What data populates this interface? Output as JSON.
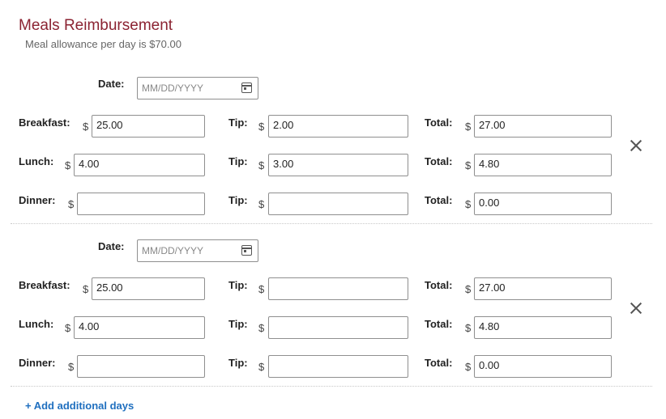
{
  "header": {
    "title": "Meals Reimbursement",
    "subtitle": "Meal allowance per day is $70.00"
  },
  "labels": {
    "date": "Date:",
    "breakfast": "Breakfast:",
    "lunch": "Lunch:",
    "dinner": "Dinner:",
    "tip": "Tip:",
    "total": "Total:",
    "currency": "$"
  },
  "days": [
    {
      "date_placeholder": "MM/DD/YYYY",
      "breakfast": {
        "amount": "25.00",
        "tip": "2.00",
        "total": "27.00"
      },
      "lunch": {
        "amount": "4.00",
        "tip": "3.00",
        "total": "4.80"
      },
      "dinner": {
        "amount": "",
        "tip": "",
        "total": "0.00"
      }
    },
    {
      "date_placeholder": "MM/DD/YYYY",
      "breakfast": {
        "amount": "25.00",
        "tip": "",
        "total": "27.00"
      },
      "lunch": {
        "amount": "4.00",
        "tip": "",
        "total": "4.80"
      },
      "dinner": {
        "amount": "",
        "tip": "",
        "total": "0.00"
      }
    }
  ],
  "actions": {
    "add_days": "+ Add additional days"
  },
  "icons": {
    "calendar": "calendar-icon",
    "remove": "close-icon"
  },
  "colors": {
    "title": "#8b2332",
    "link": "#1f6fbf"
  }
}
